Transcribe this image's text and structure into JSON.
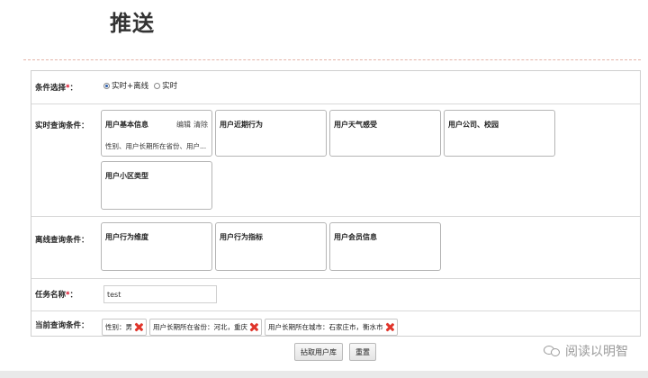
{
  "page": {
    "title": "推送"
  },
  "form": {
    "condition_select": {
      "label": "条件选择",
      "required_mark": "*",
      "suffix": "：",
      "options": [
        {
          "label": "实时+离线",
          "selected": true
        },
        {
          "label": "实时",
          "selected": false
        }
      ]
    },
    "realtime": {
      "label": "实时查询条件：",
      "cards": [
        {
          "title": "用户基本信息",
          "edit": "编辑",
          "clear": "清除",
          "desc": "性别、用户长期所在省份、用户..."
        },
        {
          "title": "用户近期行为"
        },
        {
          "title": "用户天气感受"
        },
        {
          "title": "用户公司、校园"
        },
        {
          "title": "用户小区类型"
        }
      ]
    },
    "offline": {
      "label": "离线查询条件：",
      "cards": [
        {
          "title": "用户行为维度"
        },
        {
          "title": "用户行为指标"
        },
        {
          "title": "用户会员信息"
        }
      ]
    },
    "task_name": {
      "label": "任务名称",
      "required_mark": "*",
      "suffix": "：",
      "value": "test"
    },
    "current": {
      "label": "当前查询条件：",
      "tags": [
        {
          "text": "性别：男"
        },
        {
          "text": "用户长期所在省份：河北，重庆"
        },
        {
          "text": "用户长期所在城市：石家庄市，衡水市"
        }
      ]
    }
  },
  "buttons": {
    "fetch": "拈取用户库",
    "reset": "重置"
  },
  "watermark": {
    "text": "阅读以明智"
  },
  "colors": {
    "required": "#d9001b",
    "remove": "#e0352b",
    "border": "#b5b5b5"
  }
}
